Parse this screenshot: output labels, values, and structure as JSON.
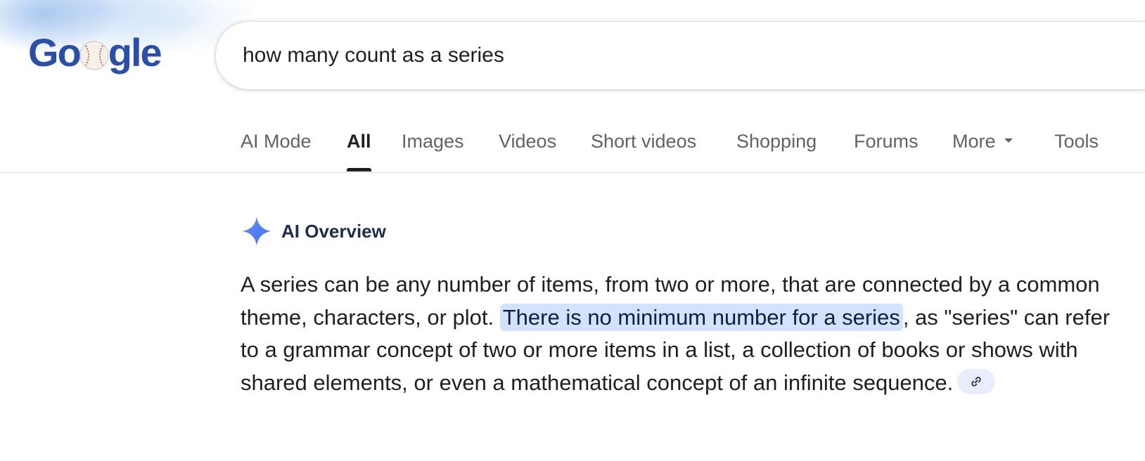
{
  "logo": {
    "text_before": "G",
    "text_after": "gle",
    "alt": "Google"
  },
  "search": {
    "query": "how many count as a series"
  },
  "tabs": [
    {
      "label": "AI Mode",
      "active": false
    },
    {
      "label": "All",
      "active": true
    },
    {
      "label": "Images",
      "active": false
    },
    {
      "label": "Videos",
      "active": false
    },
    {
      "label": "Short videos",
      "active": false
    },
    {
      "label": "Shopping",
      "active": false
    },
    {
      "label": "Forums",
      "active": false
    },
    {
      "label": "More",
      "active": false
    },
    {
      "label": "Tools",
      "active": false
    }
  ],
  "ai_overview": {
    "title": "AI Overview",
    "text_part1": "A series can be any number of items, from two or more, that are connected by a common theme, characters, or plot. ",
    "highlight": "There is no minimum number for a series",
    "text_part2": ", as \"series\" can refer to a grammar concept of two or more items in a list, a collection of books or shows with shared elements, or even a mathematical concept of an infinite sequence.",
    "link_icon": "link-icon"
  },
  "colors": {
    "accent": "#4285f4",
    "highlight_bg": "#d3e3fd",
    "logo_blue": "#2a4fa8"
  }
}
